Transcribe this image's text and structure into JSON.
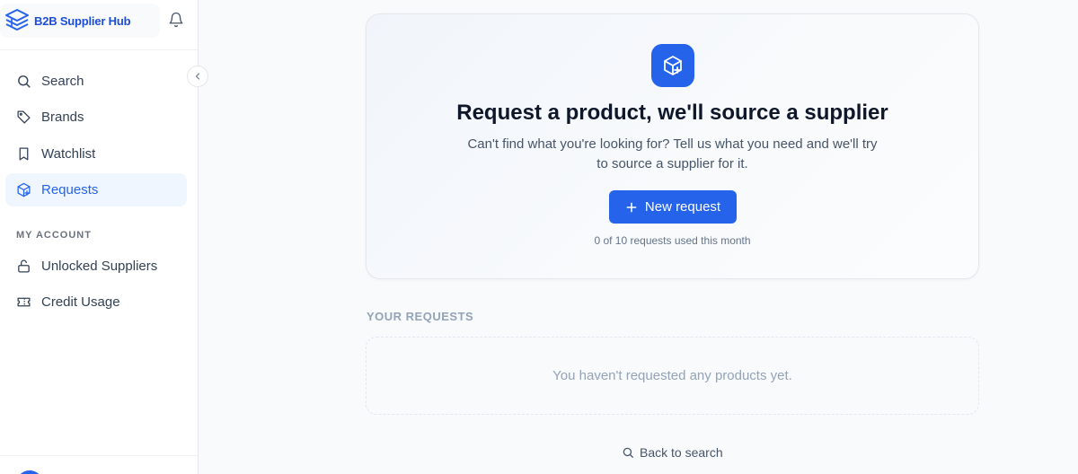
{
  "app": {
    "name": "B2B Supplier Hub",
    "logo_icon": "stacked-layers-logo",
    "accent_color": "#2563eb",
    "notifications_icon": "bell-icon",
    "collapse_icon": "chevron-left-icon"
  },
  "sidebar": {
    "items": [
      {
        "label": "Search",
        "icon": "search-icon",
        "active": false
      },
      {
        "label": "Brands",
        "icon": "tag-icon",
        "active": false
      },
      {
        "label": "Watchlist",
        "icon": "bookmark-icon",
        "active": false
      },
      {
        "label": "Requests",
        "icon": "package-plus-icon",
        "active": true
      }
    ],
    "account_section_label": "MY ACCOUNT",
    "account_items": [
      {
        "label": "Unlocked Suppliers",
        "icon": "lock-open-icon"
      },
      {
        "label": "Credit Usage",
        "icon": "ticket-icon"
      }
    ]
  },
  "hero": {
    "icon": "package-plus-icon",
    "title": "Request a product, we'll source a supplier",
    "description": "Can't find what you're looking for? Tell us what you need and we'll try to source a supplier for it.",
    "button_label": "New request",
    "button_icon": "plus-icon",
    "usage_text": "0 of 10 requests used this month"
  },
  "requests": {
    "heading": "YOUR REQUESTS",
    "empty_text": "You haven't requested any products yet."
  },
  "footer": {
    "back_label": "Back to search",
    "back_icon": "search-icon"
  }
}
